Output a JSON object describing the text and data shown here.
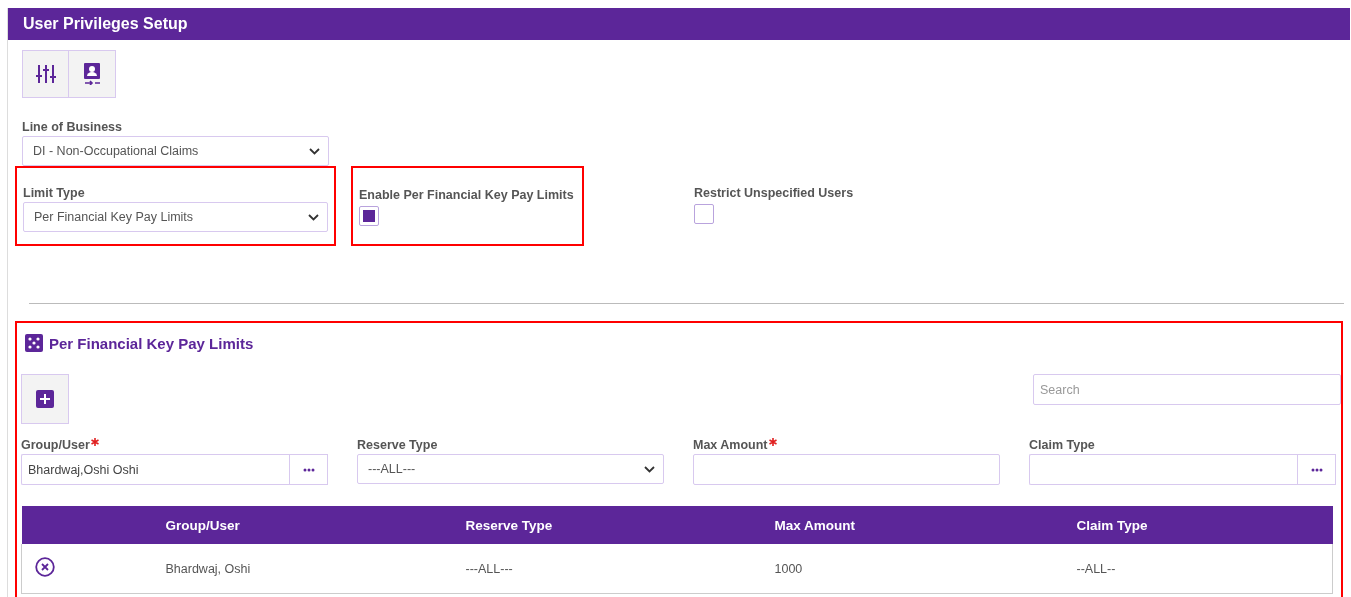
{
  "window": {
    "title": "User Privileges Setup"
  },
  "settings": [
    {
      "label": "Line of Business",
      "kind": "select",
      "value": "DI - Non-Occupational Claims",
      "highlighted": false
    },
    {
      "label": "Limit Type",
      "kind": "select",
      "value": "Per Financial Key Pay Limits",
      "highlighted": true
    },
    {
      "label": "Enable Per Financial Key Pay Limits",
      "kind": "checkbox",
      "checked": true,
      "highlighted": true
    },
    {
      "label": "Restrict Unspecified Users",
      "kind": "checkbox",
      "checked": false,
      "highlighted": false
    }
  ],
  "section": {
    "title": "Per Financial Key Pay Limits",
    "highlighted": true,
    "search": {
      "placeholder": "Search"
    },
    "fields": [
      {
        "label": "Group/User",
        "required": true,
        "kind": "lookup",
        "value": "Bhardwaj,Oshi Oshi"
      },
      {
        "label": "Reserve Type",
        "required": false,
        "kind": "select",
        "value": "---ALL---"
      },
      {
        "label": "Max Amount",
        "required": true,
        "kind": "text"
      },
      {
        "label": "Claim Type",
        "required": false,
        "kind": "lookup"
      }
    ],
    "table": {
      "columns": [
        "Group/User",
        "Reserve Type",
        "Max Amount",
        "Claim Type"
      ],
      "rows": [
        {
          "cells": [
            "Bhardwaj, Oshi",
            "---ALL---",
            "1000",
            "--ALL--"
          ]
        }
      ]
    }
  }
}
